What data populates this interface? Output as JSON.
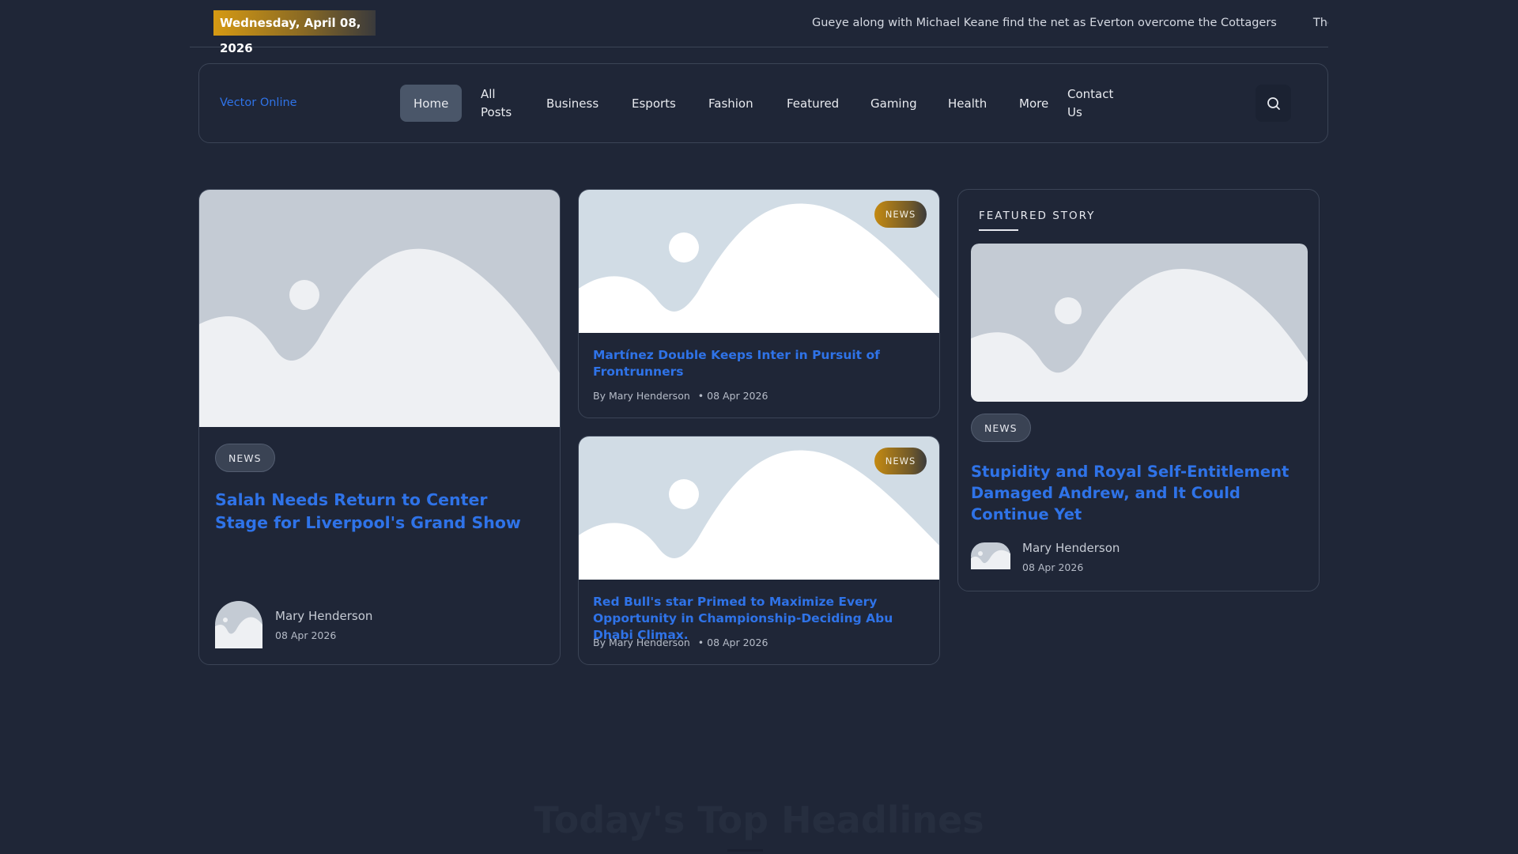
{
  "topbar": {
    "date": "Wednesday, April 08, 2026",
    "ticker": [
      "Gueye along with Michael Keane find the net as Everton overcome the Cottagers",
      "The Latest"
    ]
  },
  "nav": {
    "brand": "Vector Online",
    "items": [
      "Home",
      "All Posts",
      "Business",
      "Esports",
      "Fashion",
      "Featured",
      "Gaming",
      "Health",
      "More",
      "Contact Us"
    ],
    "search_icon": "search-icon"
  },
  "main_card": {
    "badge": "NEWS",
    "title": "Salah Needs Return to Center Stage for Liverpool's Grand Show",
    "author": "Mary Henderson",
    "date": "08 Apr 2026"
  },
  "small_cards": [
    {
      "badge": "NEWS",
      "title": "Martínez Double Keeps Inter in Pursuit of Frontrunners",
      "author": "By Mary Henderson",
      "date": "• 08 Apr 2026"
    },
    {
      "badge": "NEWS",
      "title": "Red Bull's star Primed to Maximize Every Opportunity in Championship-Deciding Abu Dhabi Climax.",
      "author": "By Mary Henderson",
      "date": "• 08 Apr 2026"
    }
  ],
  "featured": {
    "heading": "FEATURED STORY",
    "badge": "NEWS",
    "title": "Stupidity and Royal Self-Entitlement Damaged Andrew, and It Could Continue Yet",
    "author": "Mary Henderson",
    "date": "08 Apr 2026"
  },
  "section": {
    "title": "Today's Top Headlines"
  },
  "colors": {
    "background": "#1f2637",
    "accent_link": "#2f73e8",
    "gold": "#d69a13"
  }
}
